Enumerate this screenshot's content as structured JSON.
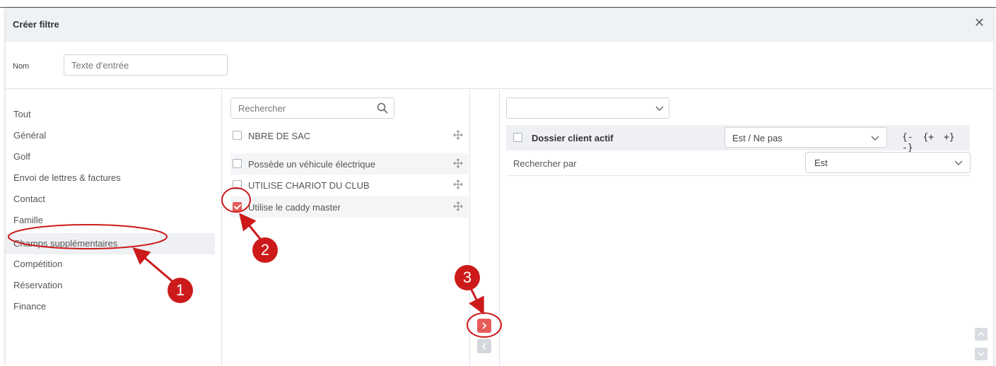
{
  "dialog": {
    "title": "Créer filtre",
    "close_icon": "close-icon"
  },
  "name_row": {
    "label": "Nom",
    "placeholder": "Texte d'entrée"
  },
  "categories": [
    {
      "label": "Tout"
    },
    {
      "label": "Général"
    },
    {
      "label": "Golf"
    },
    {
      "label": "Envoi de lettres & factures"
    },
    {
      "label": "Contact"
    },
    {
      "label": "Famille"
    },
    {
      "label": "Champs supplémentaires",
      "active": true
    },
    {
      "label": "Compétition"
    },
    {
      "label": "Réservation"
    },
    {
      "label": "Finance"
    }
  ],
  "field_search": {
    "placeholder": "Rechercher",
    "icon": "search-icon"
  },
  "fields": [
    {
      "label": "NBRE DE SAC",
      "checked": false
    },
    {
      "label": "Possède un véhicule électrique",
      "checked": false
    },
    {
      "label": "UTILISE CHARIOT DU CLUB",
      "checked": false
    },
    {
      "label": "Utilise le caddy master",
      "checked": true
    }
  ],
  "condition": {
    "title": "Dossier client actif",
    "operator": "Est / Ne pas",
    "brackets": [
      "{-",
      "{+",
      "+}",
      "-}"
    ],
    "search_by_label": "Rechercher par",
    "search_by_value": "Est"
  },
  "annotations": [
    "1",
    "2",
    "3"
  ],
  "colors": {
    "accent": "#e85b5b",
    "annotation": "#cc1a1a",
    "header_bg": "#eef1f6"
  }
}
